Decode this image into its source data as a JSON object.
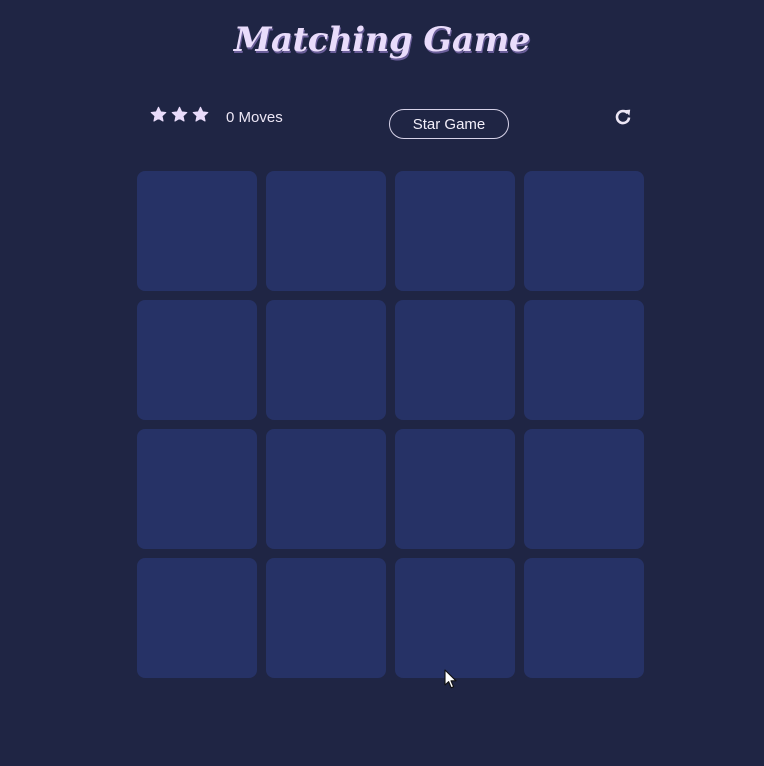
{
  "title": "Matching Game",
  "score_panel": {
    "stars": [
      "star-icon",
      "star-icon",
      "star-icon"
    ],
    "star_rating": 3,
    "moves_count": "0",
    "moves_label": "Moves",
    "start_button_label": "Star Game",
    "restart_icon": "restart-icon"
  },
  "deck": {
    "rows": 4,
    "columns": 4,
    "cards": [
      {
        "state": "face-down"
      },
      {
        "state": "face-down"
      },
      {
        "state": "face-down"
      },
      {
        "state": "face-down"
      },
      {
        "state": "face-down"
      },
      {
        "state": "face-down"
      },
      {
        "state": "face-down"
      },
      {
        "state": "face-down"
      },
      {
        "state": "face-down"
      },
      {
        "state": "face-down"
      },
      {
        "state": "face-down"
      },
      {
        "state": "face-down"
      },
      {
        "state": "face-down"
      },
      {
        "state": "face-down"
      },
      {
        "state": "face-down"
      },
      {
        "state": "face-down"
      }
    ]
  },
  "colors": {
    "background": "#1f2544",
    "card": "#263266",
    "title": "#e9dcfb",
    "text": "#ece6f5"
  }
}
